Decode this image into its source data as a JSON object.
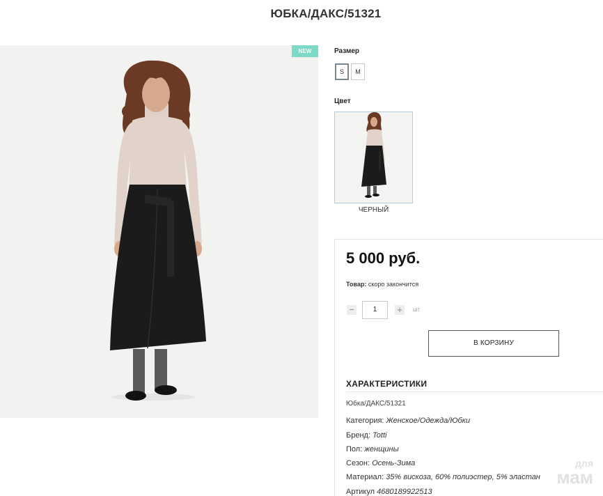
{
  "product": {
    "title": "ЮБКА/ДАКС/51321",
    "badge": "NEW"
  },
  "options": {
    "size_label": "Размер",
    "sizes": [
      "S",
      "M"
    ],
    "selected_size": "S",
    "color_label": "Цвет",
    "color_name": "ЧЕРНЫЙ"
  },
  "purchase": {
    "price": "5 000 руб.",
    "stock_label": "Товар:",
    "stock_value": "скоро закончится",
    "qty_minus": "−",
    "qty_value": "1",
    "qty_plus": "+",
    "qty_unit": "шт",
    "cart_button": "В КОРЗИНУ"
  },
  "specs": {
    "heading": "ХАРАКТЕРИСТИКИ",
    "sku_line": "Юбка/ДАКС/51321",
    "rows": [
      {
        "label": "Категория:",
        "value": "Женское/Одежда/Юбки"
      },
      {
        "label": "Бренд:",
        "value": "Totti"
      },
      {
        "label": "Пол:",
        "value": "женщины"
      },
      {
        "label": "Сезон:",
        "value": "Осень-Зима"
      },
      {
        "label": "Материал:",
        "value": "35% вискоза, 60% полиэстер, 5% эластан"
      },
      {
        "label": "Артикул",
        "value": "4680189922513"
      }
    ]
  },
  "watermark": {
    "top": "для",
    "bottom": "мам"
  },
  "colors": {
    "badge": "#7ed9c6",
    "sweater": "#e2d3ca",
    "skirt": "#1b1b1b",
    "hair": "#6b3a24"
  },
  "icons": {
    "qty_minus": "minus-icon",
    "qty_plus": "plus-icon"
  }
}
